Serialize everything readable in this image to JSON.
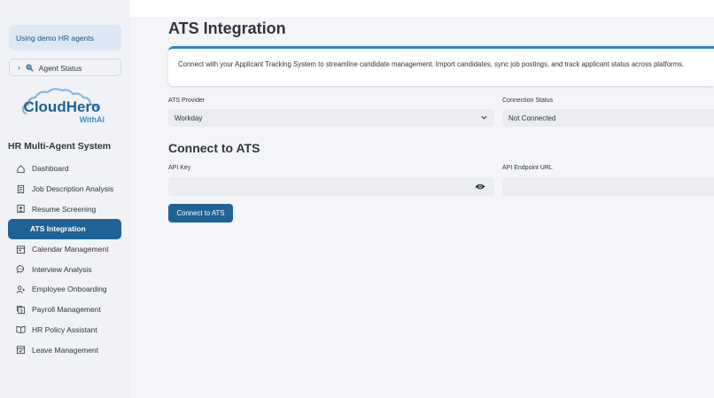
{
  "sidebar": {
    "demo_notice": "Using demo HR agents",
    "agent_status": {
      "label": "Agent Status"
    },
    "logo": {
      "text_main": "CloudHero",
      "text_sub": "WithAI"
    },
    "system_title": "HR Multi-Agent System",
    "items": [
      {
        "label": "Dashboard",
        "icon": "home-icon",
        "active": false
      },
      {
        "label": "Job Description Analysis",
        "icon": "document-icon",
        "active": false
      },
      {
        "label": "Resume Screening",
        "icon": "id-card-icon",
        "active": false
      },
      {
        "label": "ATS Integration",
        "icon": "",
        "active": true
      },
      {
        "label": "Calendar Management",
        "icon": "calendar-icon",
        "active": false
      },
      {
        "label": "Interview Analysis",
        "icon": "chat-icon",
        "active": false
      },
      {
        "label": "Employee Onboarding",
        "icon": "user-add-icon",
        "active": false
      },
      {
        "label": "Payroll Management",
        "icon": "payroll-icon",
        "active": false
      },
      {
        "label": "HR Policy Assistant",
        "icon": "book-icon",
        "active": false
      },
      {
        "label": "Leave Management",
        "icon": "calendar-check-icon",
        "active": false
      }
    ]
  },
  "main": {
    "title": "ATS Integration",
    "info": "Connect with your Applicant Tracking System to streamline candidate management. Import candidates, sync job postings, and track applicant status across platforms.",
    "ats_provider": {
      "label": "ATS Provider",
      "value": "Workday"
    },
    "connection_status": {
      "label": "Connection Status",
      "value": "Not Connected"
    },
    "connect_section": {
      "title": "Connect to ATS",
      "api_key_label": "API Key",
      "api_key_value": "",
      "endpoint_label": "API Endpoint URL",
      "endpoint_value": "",
      "button_label": "Connect to ATS"
    }
  },
  "colors": {
    "sidebar_bg": "#f0f2f6",
    "active_item": "#1f6296",
    "button": "#1f6296",
    "info_accent": "#2e86c1",
    "demo_notice_bg": "#dde8f5"
  }
}
